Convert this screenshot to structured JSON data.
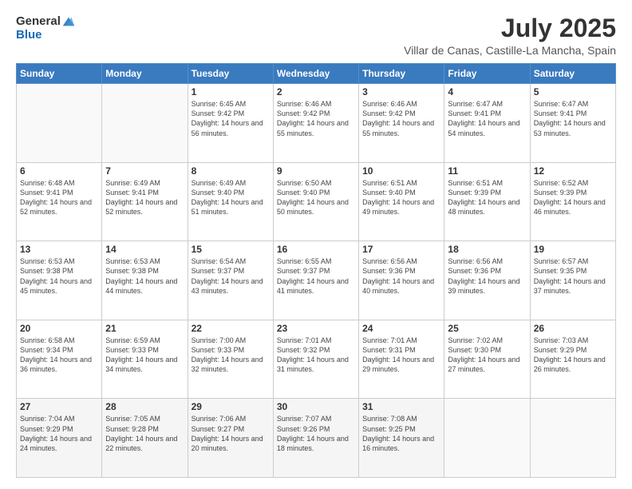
{
  "header": {
    "logo_general": "General",
    "logo_blue": "Blue",
    "title": "July 2025",
    "subtitle": "Villar de Canas, Castille-La Mancha, Spain"
  },
  "calendar": {
    "headers": [
      "Sunday",
      "Monday",
      "Tuesday",
      "Wednesday",
      "Thursday",
      "Friday",
      "Saturday"
    ],
    "weeks": [
      [
        {
          "day": "",
          "info": ""
        },
        {
          "day": "",
          "info": ""
        },
        {
          "day": "1",
          "info": "Sunrise: 6:45 AM\nSunset: 9:42 PM\nDaylight: 14 hours and 56 minutes."
        },
        {
          "day": "2",
          "info": "Sunrise: 6:46 AM\nSunset: 9:42 PM\nDaylight: 14 hours and 55 minutes."
        },
        {
          "day": "3",
          "info": "Sunrise: 6:46 AM\nSunset: 9:42 PM\nDaylight: 14 hours and 55 minutes."
        },
        {
          "day": "4",
          "info": "Sunrise: 6:47 AM\nSunset: 9:41 PM\nDaylight: 14 hours and 54 minutes."
        },
        {
          "day": "5",
          "info": "Sunrise: 6:47 AM\nSunset: 9:41 PM\nDaylight: 14 hours and 53 minutes."
        }
      ],
      [
        {
          "day": "6",
          "info": "Sunrise: 6:48 AM\nSunset: 9:41 PM\nDaylight: 14 hours and 52 minutes."
        },
        {
          "day": "7",
          "info": "Sunrise: 6:49 AM\nSunset: 9:41 PM\nDaylight: 14 hours and 52 minutes."
        },
        {
          "day": "8",
          "info": "Sunrise: 6:49 AM\nSunset: 9:40 PM\nDaylight: 14 hours and 51 minutes."
        },
        {
          "day": "9",
          "info": "Sunrise: 6:50 AM\nSunset: 9:40 PM\nDaylight: 14 hours and 50 minutes."
        },
        {
          "day": "10",
          "info": "Sunrise: 6:51 AM\nSunset: 9:40 PM\nDaylight: 14 hours and 49 minutes."
        },
        {
          "day": "11",
          "info": "Sunrise: 6:51 AM\nSunset: 9:39 PM\nDaylight: 14 hours and 48 minutes."
        },
        {
          "day": "12",
          "info": "Sunrise: 6:52 AM\nSunset: 9:39 PM\nDaylight: 14 hours and 46 minutes."
        }
      ],
      [
        {
          "day": "13",
          "info": "Sunrise: 6:53 AM\nSunset: 9:38 PM\nDaylight: 14 hours and 45 minutes."
        },
        {
          "day": "14",
          "info": "Sunrise: 6:53 AM\nSunset: 9:38 PM\nDaylight: 14 hours and 44 minutes."
        },
        {
          "day": "15",
          "info": "Sunrise: 6:54 AM\nSunset: 9:37 PM\nDaylight: 14 hours and 43 minutes."
        },
        {
          "day": "16",
          "info": "Sunrise: 6:55 AM\nSunset: 9:37 PM\nDaylight: 14 hours and 41 minutes."
        },
        {
          "day": "17",
          "info": "Sunrise: 6:56 AM\nSunset: 9:36 PM\nDaylight: 14 hours and 40 minutes."
        },
        {
          "day": "18",
          "info": "Sunrise: 6:56 AM\nSunset: 9:36 PM\nDaylight: 14 hours and 39 minutes."
        },
        {
          "day": "19",
          "info": "Sunrise: 6:57 AM\nSunset: 9:35 PM\nDaylight: 14 hours and 37 minutes."
        }
      ],
      [
        {
          "day": "20",
          "info": "Sunrise: 6:58 AM\nSunset: 9:34 PM\nDaylight: 14 hours and 36 minutes."
        },
        {
          "day": "21",
          "info": "Sunrise: 6:59 AM\nSunset: 9:33 PM\nDaylight: 14 hours and 34 minutes."
        },
        {
          "day": "22",
          "info": "Sunrise: 7:00 AM\nSunset: 9:33 PM\nDaylight: 14 hours and 32 minutes."
        },
        {
          "day": "23",
          "info": "Sunrise: 7:01 AM\nSunset: 9:32 PM\nDaylight: 14 hours and 31 minutes."
        },
        {
          "day": "24",
          "info": "Sunrise: 7:01 AM\nSunset: 9:31 PM\nDaylight: 14 hours and 29 minutes."
        },
        {
          "day": "25",
          "info": "Sunrise: 7:02 AM\nSunset: 9:30 PM\nDaylight: 14 hours and 27 minutes."
        },
        {
          "day": "26",
          "info": "Sunrise: 7:03 AM\nSunset: 9:29 PM\nDaylight: 14 hours and 26 minutes."
        }
      ],
      [
        {
          "day": "27",
          "info": "Sunrise: 7:04 AM\nSunset: 9:29 PM\nDaylight: 14 hours and 24 minutes."
        },
        {
          "day": "28",
          "info": "Sunrise: 7:05 AM\nSunset: 9:28 PM\nDaylight: 14 hours and 22 minutes."
        },
        {
          "day": "29",
          "info": "Sunrise: 7:06 AM\nSunset: 9:27 PM\nDaylight: 14 hours and 20 minutes."
        },
        {
          "day": "30",
          "info": "Sunrise: 7:07 AM\nSunset: 9:26 PM\nDaylight: 14 hours and 18 minutes."
        },
        {
          "day": "31",
          "info": "Sunrise: 7:08 AM\nSunset: 9:25 PM\nDaylight: 14 hours and 16 minutes."
        },
        {
          "day": "",
          "info": ""
        },
        {
          "day": "",
          "info": ""
        }
      ]
    ]
  }
}
